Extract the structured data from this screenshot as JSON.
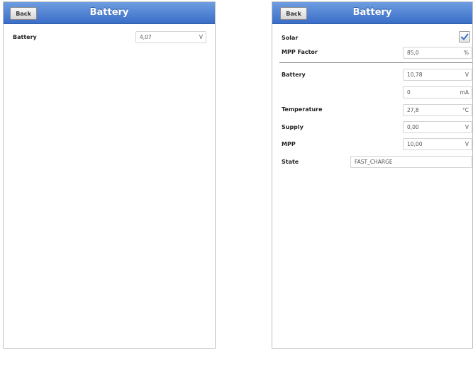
{
  "left_screen": {
    "back_label": "Back",
    "title": "Battery",
    "battery": {
      "label": "Battery",
      "value": "4,07",
      "unit": "V"
    }
  },
  "right_screen": {
    "back_label": "Back",
    "title": "Battery",
    "solar": {
      "label": "Solar",
      "checked": true
    },
    "mpp_factor": {
      "label": "MPP Factor",
      "value": "85,0",
      "unit": "%"
    },
    "battery_voltage": {
      "label": "Battery",
      "value": "10,78",
      "unit": "V"
    },
    "battery_current": {
      "value": "0",
      "unit": "mA"
    },
    "temperature": {
      "label": "Temperature",
      "value": "27,8",
      "unit": "°C"
    },
    "supply": {
      "label": "Supply",
      "value": "0,00",
      "unit": "V"
    },
    "mpp": {
      "label": "MPP",
      "value": "10,00",
      "unit": "V"
    },
    "state": {
      "label": "State",
      "value": "FAST_CHARGE"
    }
  },
  "colors": {
    "navbar": "#4a7fd0",
    "checkmark": "#3a73c9"
  }
}
